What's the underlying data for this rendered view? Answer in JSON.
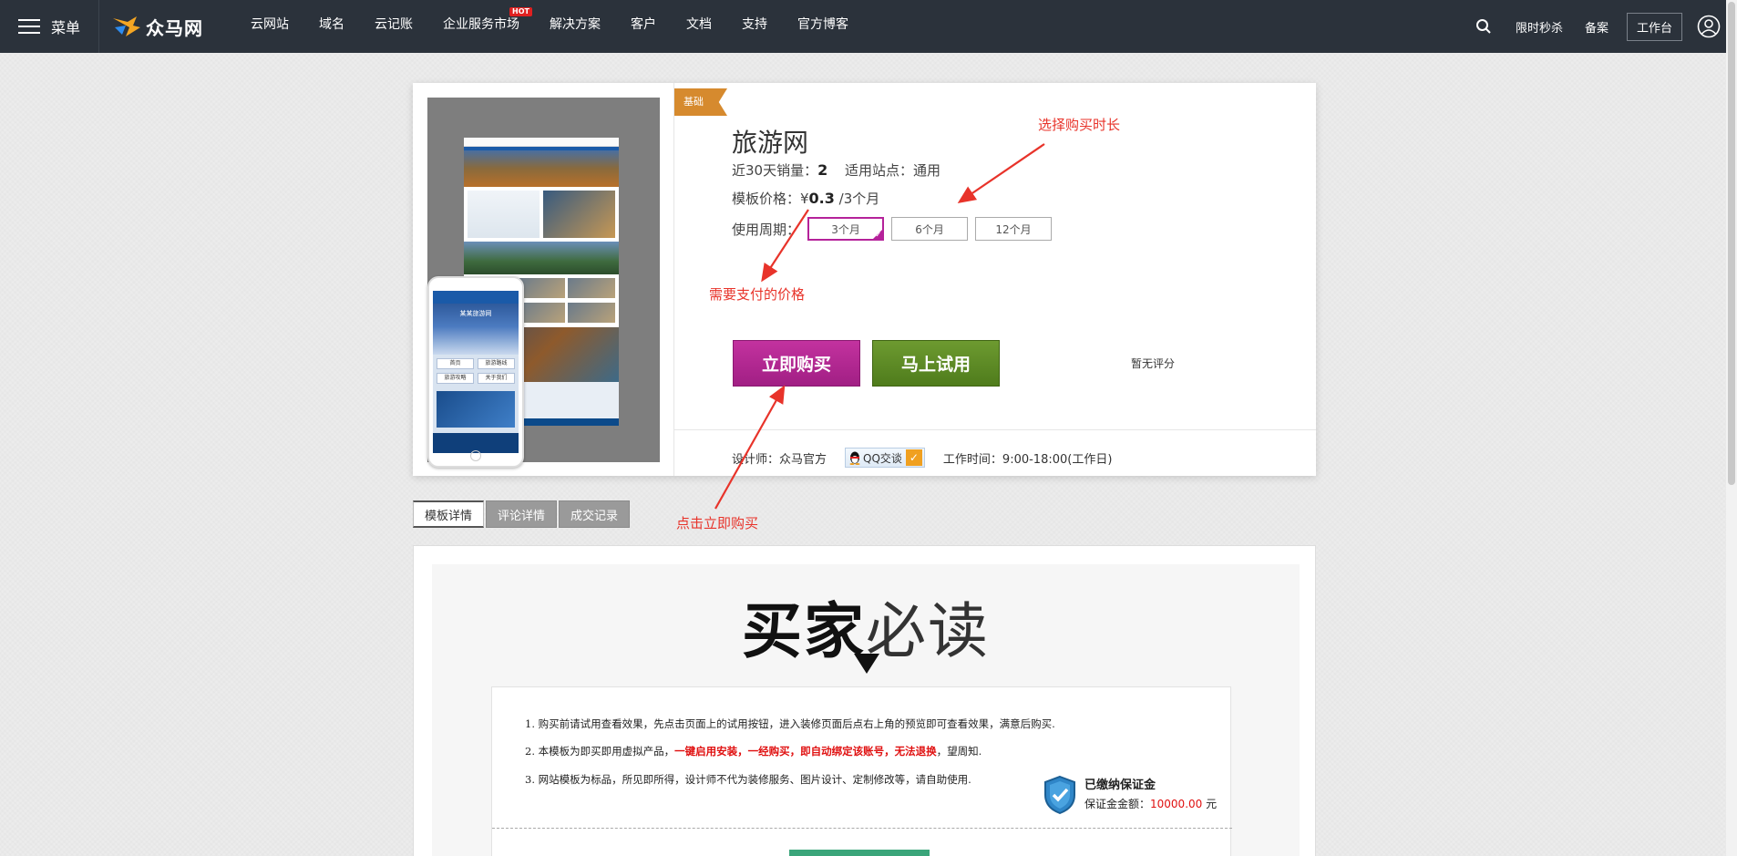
{
  "nav": {
    "menu_label": "菜单",
    "logo_text": "众马网",
    "links": [
      {
        "label": "云网站"
      },
      {
        "label": "域名"
      },
      {
        "label": "云记账"
      },
      {
        "label": "企业服务市场",
        "badge": "HOT"
      },
      {
        "label": "解决方案"
      },
      {
        "label": "客户"
      },
      {
        "label": "文档"
      },
      {
        "label": "支持"
      },
      {
        "label": "官方博客"
      }
    ],
    "right": {
      "flash_sale": "限时秒杀",
      "filing": "备案",
      "workbench": "工作台"
    }
  },
  "product": {
    "tier": "基础",
    "title": "旅游网",
    "sales_label": "近30天销量：",
    "sales_value": "2",
    "site_label": "适用站点：通用",
    "price_label": "模板价格：¥",
    "price_value": "0.3",
    "price_unit": " /3个月",
    "period_label": "使用周期：",
    "periods": [
      {
        "label": "3个月",
        "selected": true
      },
      {
        "label": "6个月",
        "selected": false
      },
      {
        "label": "12个月",
        "selected": false
      }
    ],
    "buy_label": "立即购买",
    "try_label": "马上试用",
    "rating_text": "暂无评分",
    "designer_label": "设计师：众马官方",
    "qq_label": "QQ交谈",
    "work_hours": "工作时间：9:00-18:00(工作日)",
    "phone_shot_title": "某某旅游网",
    "phone_shot_buttons": [
      "首页",
      "旅游路线",
      "旅游攻略",
      "关于我们"
    ]
  },
  "tabs": [
    {
      "label": "模板详情",
      "active": true
    },
    {
      "label": "评论详情",
      "active": false
    },
    {
      "label": "成交记录",
      "active": false
    }
  ],
  "details": {
    "title_bold": "买家",
    "title_light": "必读",
    "line1": "1. 购买前请试用查看效果，先点击页面上的试用按钮，进入装修页面后点右上角的预览即可查看效果，满意后购买.",
    "line2_a": "2. 本模板为即买即用虚拟产品，",
    "line2_red": "一键启用安装，一经购买，即自动绑定该账号，无法退换",
    "line2_b": "，望周知.",
    "line3": "3. 网站模板为标品，所见即所得，设计师不代为装修服务、图片设计、定制修改等，请自助使用.",
    "deposit_title": "已缴纳保证金",
    "deposit_label": "保证金金额：",
    "deposit_amount": "10000.00",
    "deposit_unit": " 元"
  },
  "annotations": {
    "choose_duration": "选择购买时长",
    "price_to_pay": "需要支付的价格",
    "click_buy": "点击立即购买"
  },
  "colors": {
    "nav_bg": "#2b323b",
    "buy_button": "#b22a91",
    "try_button": "#5e8a26",
    "tier_ribbon": "#d68a2e",
    "annotation": "#e8332a",
    "warning_red": "#e01010"
  }
}
